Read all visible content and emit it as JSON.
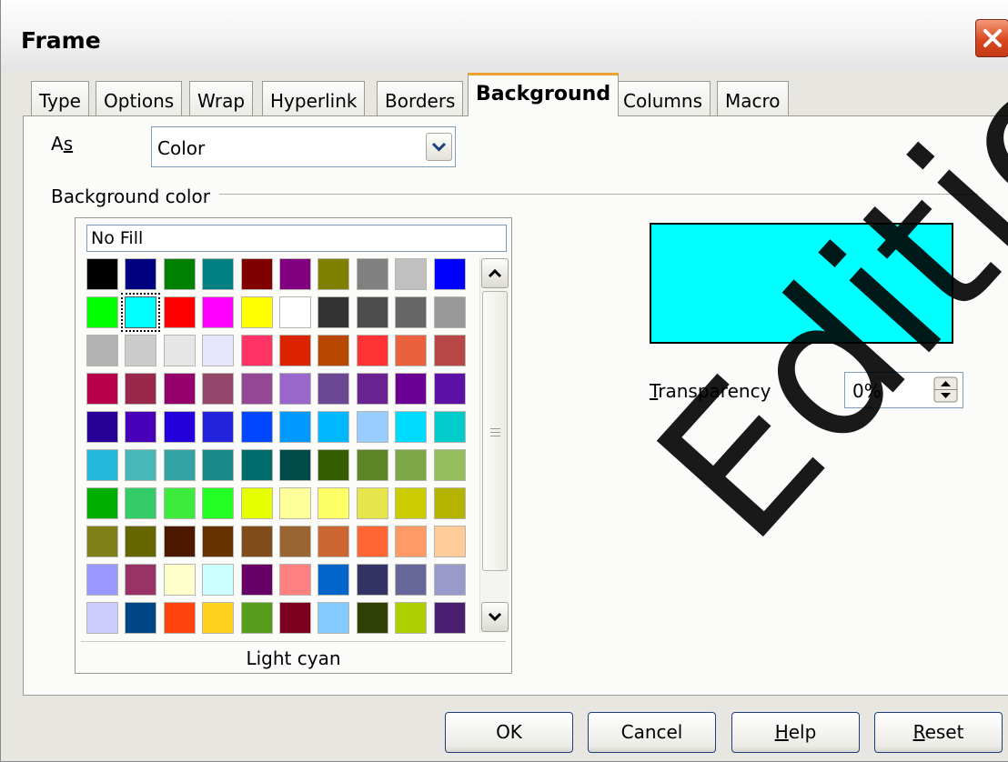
{
  "window": {
    "title": "Frame"
  },
  "tabs": [
    {
      "label": "Type"
    },
    {
      "label": "Options"
    },
    {
      "label": "Wrap"
    },
    {
      "label": "Hyperlink"
    },
    {
      "label": "Borders"
    },
    {
      "label": "Background",
      "active": true
    },
    {
      "label": "Columns"
    },
    {
      "label": "Macro"
    }
  ],
  "as_field": {
    "label": "As",
    "value": "Color"
  },
  "background_color": {
    "section_label": "Background color",
    "no_fill_label": "No Fill",
    "selected_color_name": "Light cyan",
    "selected_color": "#00ffff",
    "swatches": [
      [
        "#000000",
        "#000080",
        "#008000",
        "#008080",
        "#800000",
        "#800080",
        "#808000",
        "#808080",
        "#c0c0c0",
        "#0000ff"
      ],
      [
        "#00ff00",
        "#00ffff",
        "#ff0000",
        "#ff00ff",
        "#ffff00",
        "#ffffff",
        "#333333",
        "#4d4d4d",
        "#666666",
        "#999999"
      ],
      [
        "#b3b3b3",
        "#cccccc",
        "#e6e6e6",
        "#e6e6ff",
        "#ff3366",
        "#dc2300",
        "#b84700",
        "#ff3333",
        "#eb613d",
        "#b84747"
      ],
      [
        "#b8004b",
        "#99284c",
        "#94006b",
        "#94476b",
        "#944794",
        "#9966cc",
        "#6b4794",
        "#6b2394",
        "#6b0094",
        "#5e11a6"
      ],
      [
        "#280099",
        "#4700b8",
        "#2300dc",
        "#2323dc",
        "#0047ff",
        "#0099ff",
        "#00b8ff",
        "#99ccff",
        "#00dcff",
        "#00cccc"
      ],
      [
        "#23b8dc",
        "#47b8b8",
        "#33a3a3",
        "#198a8a",
        "#006b6b",
        "#004a4a",
        "#355e00",
        "#5c8526",
        "#7da647",
        "#94bd5e"
      ],
      [
        "#00ae00",
        "#33cc66",
        "#3deb3d",
        "#23ff23",
        "#e6ff00",
        "#ffff99",
        "#ffff66",
        "#e6e64c",
        "#cccc00",
        "#b3b300"
      ],
      [
        "#808019",
        "#666600",
        "#4c1900",
        "#663300",
        "#804c19",
        "#996633",
        "#cc6633",
        "#ff6633",
        "#ff9966",
        "#ffcc99"
      ],
      [
        "#9999ff",
        "#993366",
        "#ffffcc",
        "#ccffff",
        "#660066",
        "#ff8080",
        "#0066cc",
        "#333366",
        "#666699",
        "#9999cc"
      ],
      [
        "#ccccff",
        "#004586",
        "#ff420e",
        "#ffd320",
        "#579d1c",
        "#7e0021",
        "#83caff",
        "#314004",
        "#aecf00",
        "#4b1f6f"
      ]
    ]
  },
  "transparency": {
    "label": "Transparency",
    "value": "0%"
  },
  "buttons": {
    "ok": "OK",
    "cancel": "Cancel",
    "help": "Help",
    "reset": "Reset"
  },
  "watermark": "Editio"
}
